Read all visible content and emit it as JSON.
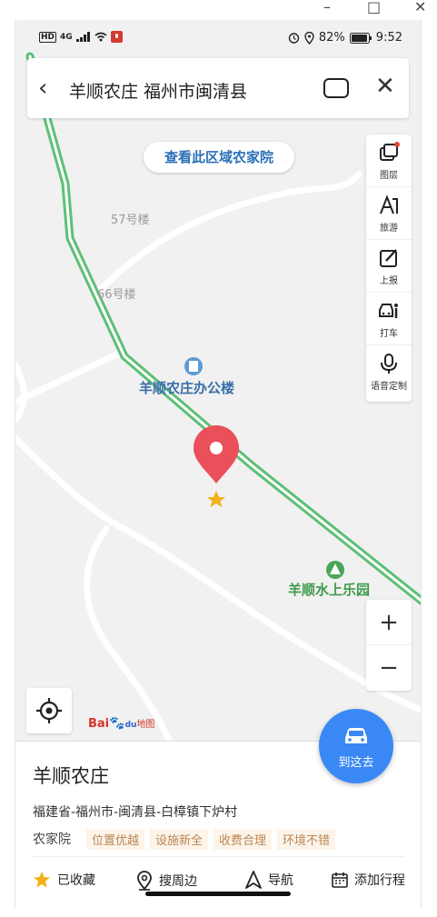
{
  "window": {
    "minimize": "–",
    "maximize": "□",
    "close": "✕"
  },
  "status": {
    "hd": "HD",
    "net": "4G",
    "battery": "82%",
    "time": "9:52"
  },
  "search": {
    "query": "羊顺农庄 福州市闽清县"
  },
  "map": {
    "region_button": "查看此区域农家院",
    "labels": {
      "building57": "57号楼",
      "building66": "66号楼",
      "office": "羊顺农庄办公楼",
      "park": "羊顺水上乐园"
    },
    "logo": {
      "text": "Bai",
      "paw": "du",
      "suffix": "地图"
    }
  },
  "tools": [
    {
      "icon": "layers-icon",
      "label": "图层"
    },
    {
      "icon": "travel-icon",
      "label": "旅游"
    },
    {
      "icon": "report-icon",
      "label": "上报"
    },
    {
      "icon": "taxi-icon",
      "label": "打车"
    },
    {
      "icon": "microphone-icon",
      "label": "语音定制"
    }
  ],
  "zoom": {
    "in": "+",
    "out": "−"
  },
  "goto": {
    "label": "到这去"
  },
  "place": {
    "name": "羊顺农庄",
    "address": "福建省-福州市-闽清县-白樟镇下炉村",
    "category": "农家院",
    "tags": [
      "位置优越",
      "设施新全",
      "收费合理",
      "环境不错"
    ]
  },
  "actions": {
    "favorite": "已收藏",
    "nearby": "搜周边",
    "navigate": "导航",
    "itinerary": "添加行程"
  },
  "colors": {
    "road_green": "#5cc076",
    "accent": "#3a88f5",
    "pin": "#e9505a"
  }
}
